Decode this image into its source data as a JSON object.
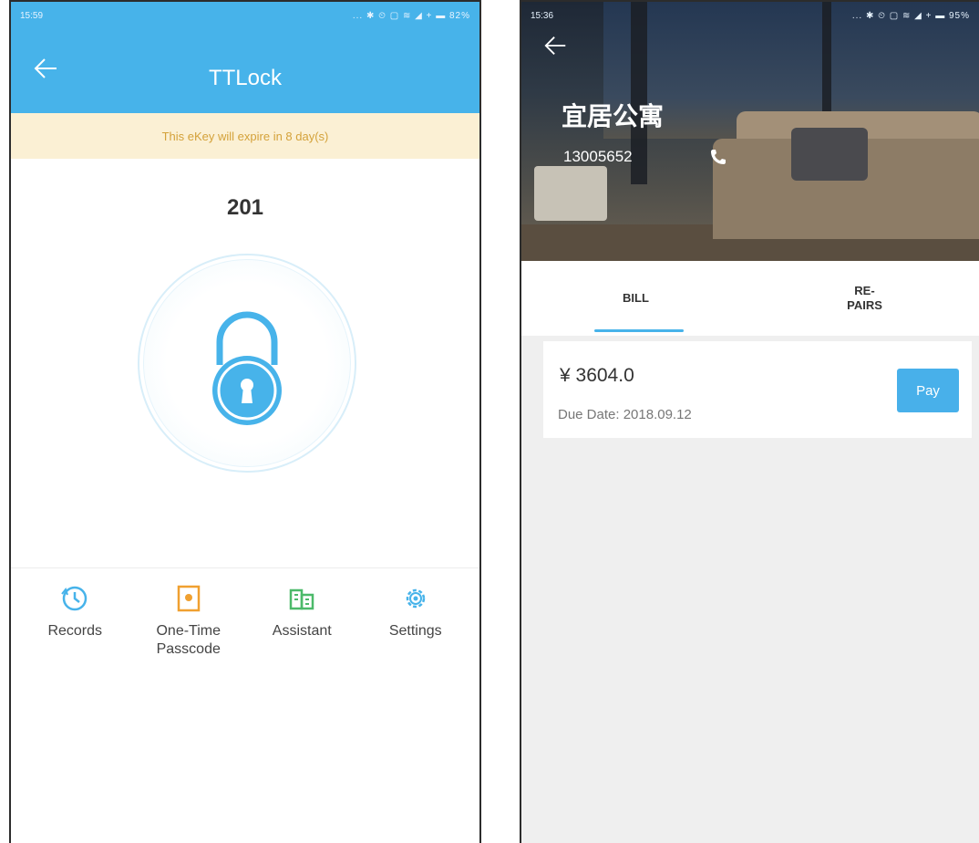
{
  "left_screen": {
    "status_bar": {
      "time": "15:59",
      "icons": "... ✱ ⏲ ▢ ≋ ◢ + ▬ 82%"
    },
    "header": {
      "back_icon": "arrow-left-icon",
      "title": "TTLock"
    },
    "expiry_banner": "This eKey will expire in 8 day(s)",
    "lock_name": "201",
    "lock_icon": "padlock-icon",
    "colors": {
      "accent": "#47b3ea",
      "banner_bg": "#fbf0d4",
      "banner_text": "#d4a23a"
    },
    "actions": [
      {
        "label": "Records",
        "icon": "clock-icon",
        "color": "#47b3ea"
      },
      {
        "label": "One-Time Passcode",
        "icon": "passcode-icon",
        "color": "#f0a030"
      },
      {
        "label": "Assistant",
        "icon": "building-icon",
        "color": "#4cba6a"
      },
      {
        "label": "Settings",
        "icon": "gear-icon",
        "color": "#47b3ea"
      }
    ]
  },
  "right_screen": {
    "status_bar": {
      "time": "15:36",
      "icons": "... ✱ ⏲ ▢ ≋ ◢ + ▬ 95%"
    },
    "back_icon": "arrow-left-icon",
    "apartment_name": "宜居公寓",
    "phone": "13005652",
    "call_icon": "phone-icon",
    "tabs": [
      {
        "label": "BILL",
        "active": true
      },
      {
        "label": "RE-\nPAIRS",
        "active": false
      }
    ],
    "bill": {
      "amount": "¥ 3604.0",
      "due_date": "Due Date: 2018.09.12",
      "pay_label": "Pay"
    },
    "colors": {
      "accent": "#47b3ea",
      "background": "#efefef"
    }
  }
}
